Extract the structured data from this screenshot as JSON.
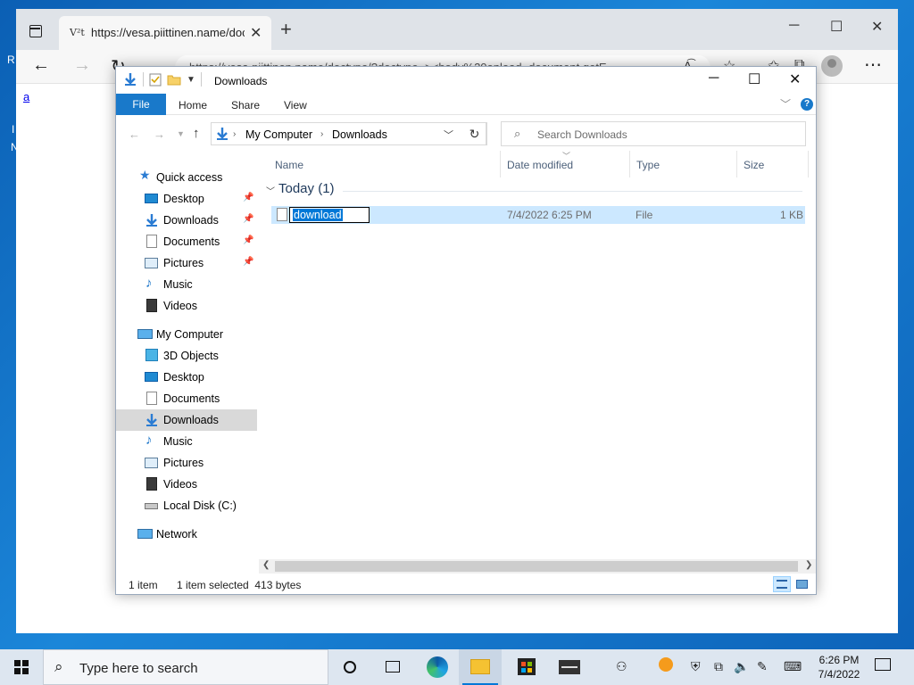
{
  "desktop": {
    "side_letters": [
      "R",
      "I",
      "N"
    ]
  },
  "browser": {
    "tab_favicon": "V²t",
    "tab_title": "https://vesa.piittinen.name/doct",
    "url": "https://vesa.piittinen.name/doctype/?doctype=><body%20onload=document.getE...",
    "page_link": "a",
    "icons": [
      "sidebar-icon",
      "close-icon",
      "plus-icon",
      "minimize-icon",
      "maximize-icon",
      "back-icon",
      "forward-icon",
      "refresh-icon",
      "read-aloud-icon",
      "favorite-icon",
      "favorites-icon",
      "collections-icon",
      "profile-icon",
      "more-icon"
    ]
  },
  "explorer": {
    "title": "Downloads",
    "ribbon_tabs": {
      "file": "File",
      "home": "Home",
      "share": "Share",
      "view": "View"
    },
    "breadcrumb": [
      "My Computer",
      "Downloads"
    ],
    "search_placeholder": "Search Downloads",
    "nav": {
      "quick_access": "Quick access",
      "qa_items": [
        "Desktop",
        "Downloads",
        "Documents",
        "Pictures",
        "Music",
        "Videos"
      ],
      "my_computer": "My Computer",
      "pc_items": [
        "3D Objects",
        "Desktop",
        "Documents",
        "Downloads",
        "Music",
        "Pictures",
        "Videos",
        "Local Disk (C:)"
      ],
      "network": "Network",
      "selected": "Downloads"
    },
    "columns": {
      "name": "Name",
      "date": "Date modified",
      "type": "Type",
      "size": "Size"
    },
    "group": "Today (1)",
    "file": {
      "name": "download",
      "date": "7/4/2022 6:25 PM",
      "type": "File",
      "size": "1 KB"
    },
    "status": {
      "count": "1 item",
      "selection": "1 item selected  413 bytes"
    }
  },
  "taskbar": {
    "search_placeholder": "Type here to search",
    "time": "6:26 PM",
    "date": "7/4/2022"
  }
}
